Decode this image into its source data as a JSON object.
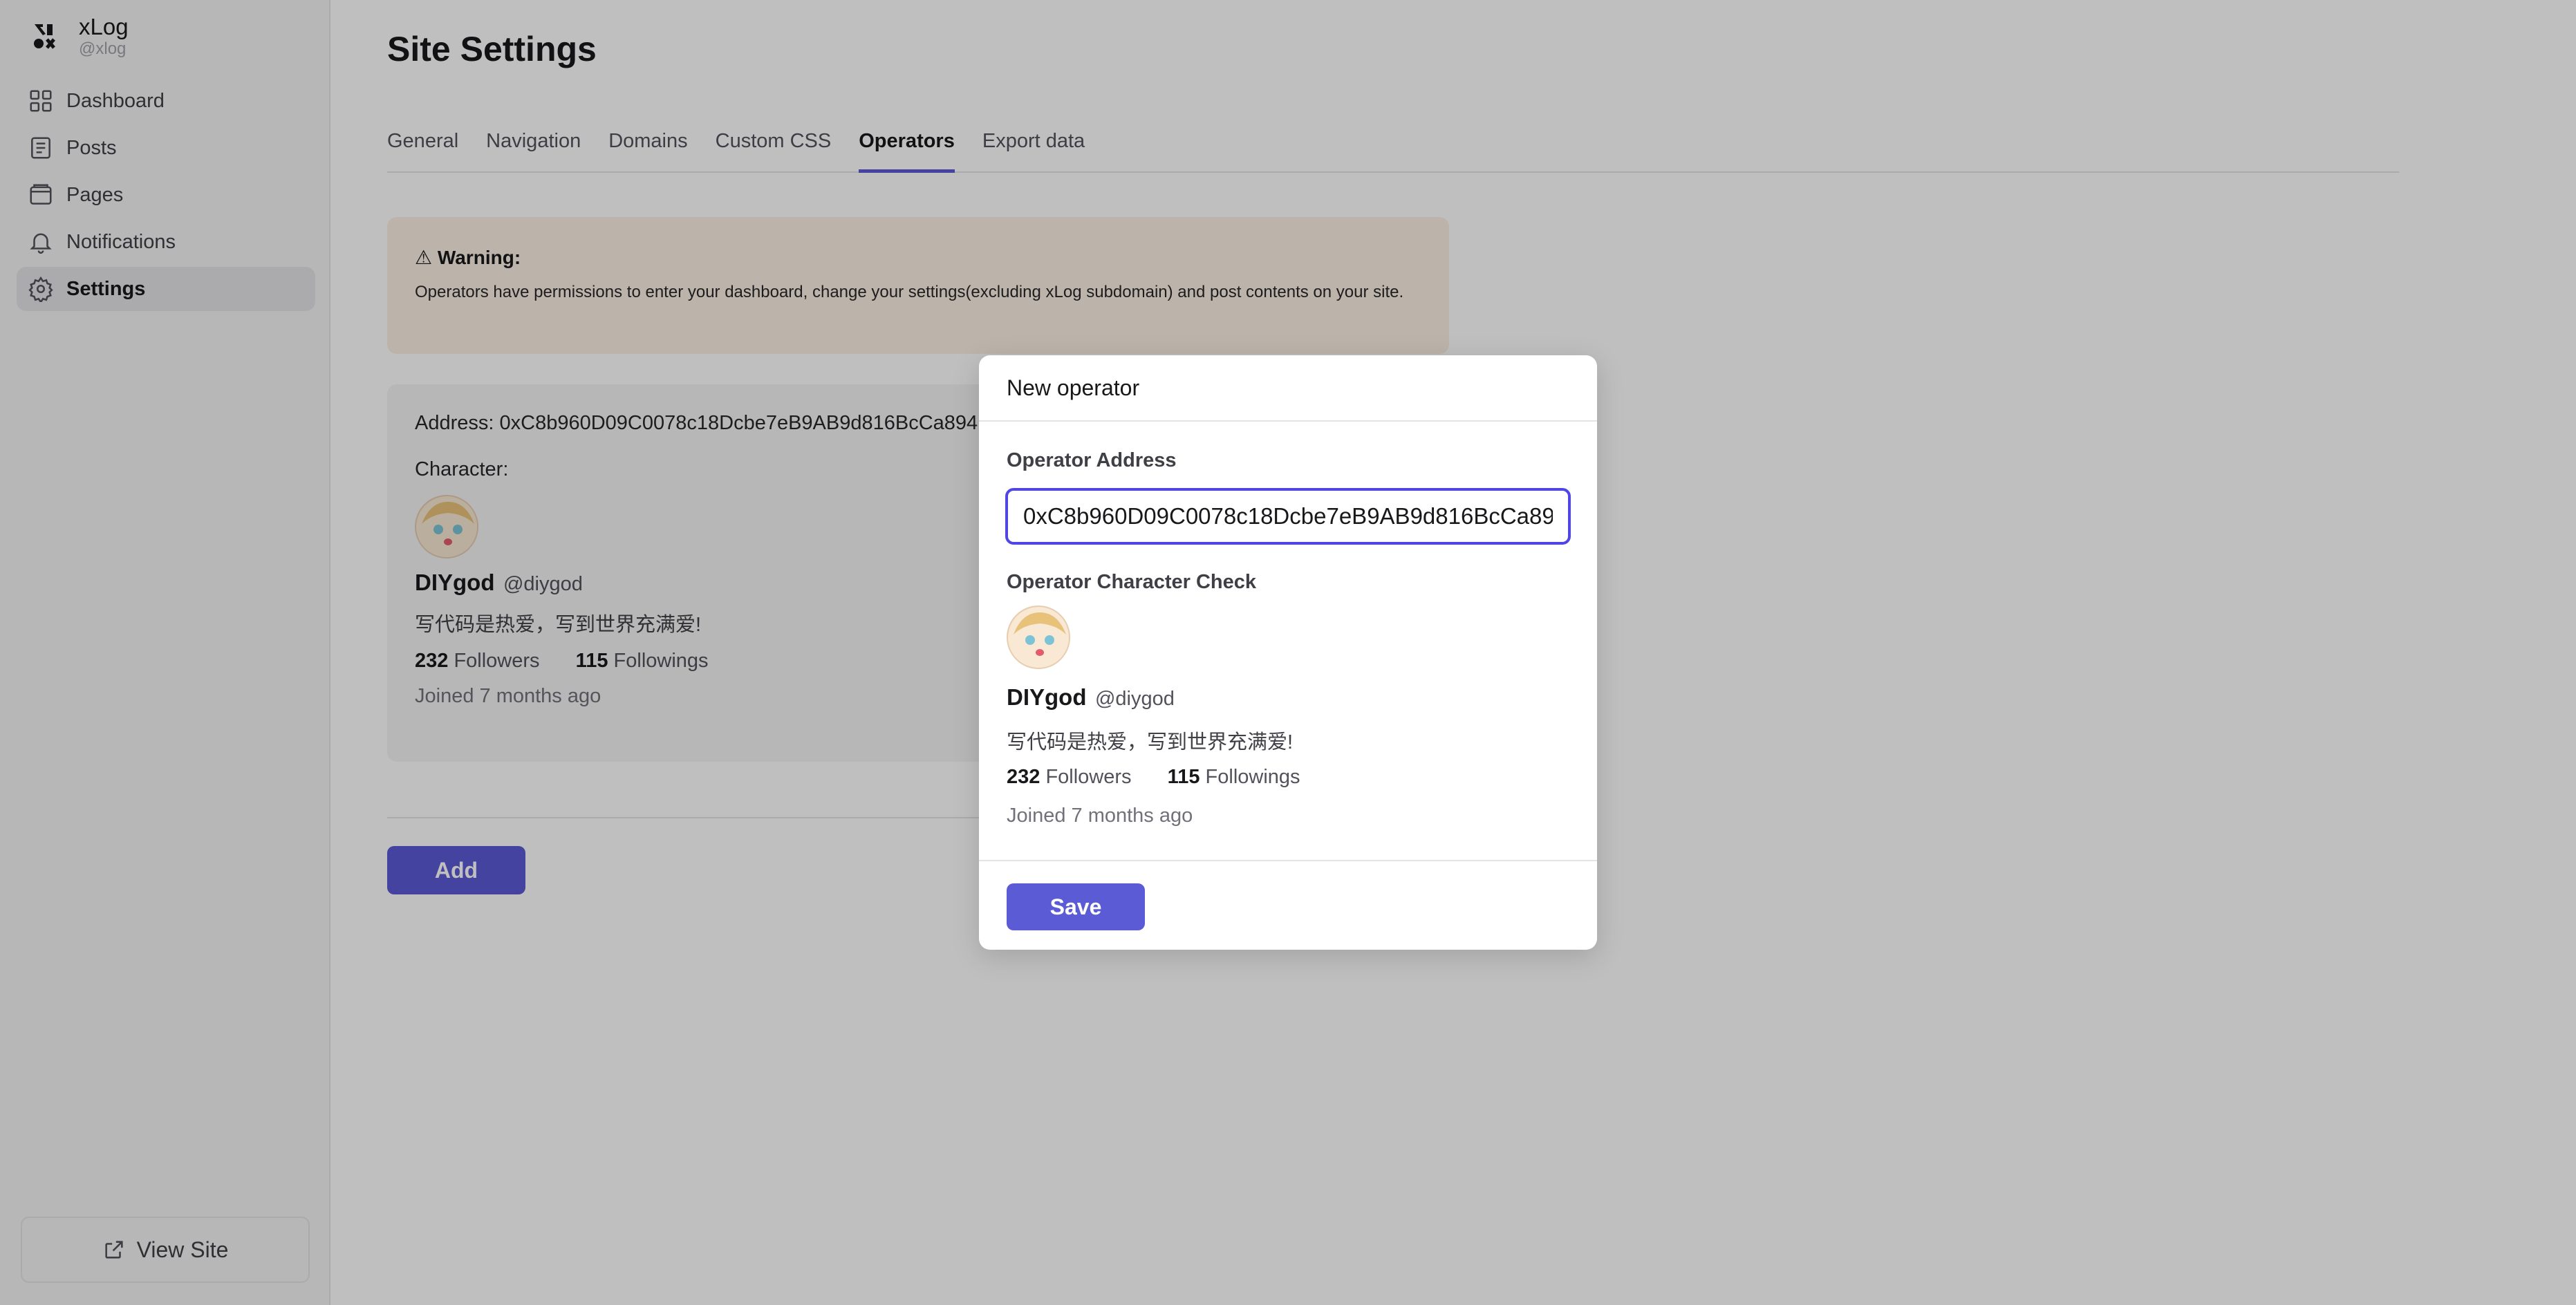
{
  "brand": {
    "name": "xLog",
    "handle": "@xlog"
  },
  "sidebar": {
    "items": [
      {
        "label": "Dashboard",
        "icon": "dashboard-icon"
      },
      {
        "label": "Posts",
        "icon": "posts-icon"
      },
      {
        "label": "Pages",
        "icon": "pages-icon"
      },
      {
        "label": "Notifications",
        "icon": "bell-icon"
      },
      {
        "label": "Settings",
        "icon": "gear-icon",
        "active": true
      }
    ],
    "view_site": "View Site"
  },
  "page": {
    "title": "Site Settings"
  },
  "tabs": [
    {
      "label": "General"
    },
    {
      "label": "Navigation"
    },
    {
      "label": "Domains"
    },
    {
      "label": "Custom CSS"
    },
    {
      "label": "Operators",
      "active": true
    },
    {
      "label": "Export data"
    }
  ],
  "warning": {
    "title": "⚠ Warning:",
    "text": "Operators have permissions to enter your dashboard, change your settings(excluding xLog subdomain) and post contents on your site."
  },
  "operator": {
    "address_line": "Address: 0xC8b960D09C0078c18Dcbe7eB9AB9d816BcCa894",
    "character_label": "Character:",
    "name": "DIYgod",
    "handle": "@diygod",
    "bio": "写代码是热爱，写到世界充满爱!",
    "followers_count": "232",
    "followers_label": "Followers",
    "followings_count": "115",
    "followings_label": "Followings",
    "joined": "Joined 7 months ago"
  },
  "add_button": "Add",
  "modal": {
    "title": "New operator",
    "address_label": "Operator Address",
    "address_value": "0xC8b960D09C0078c18Dcbe7eB9AB9d816BcCa89",
    "check_label": "Operator Character Check",
    "save_button": "Save"
  },
  "colors": {
    "accent": "#5b5bd6",
    "input_border": "#4f46e5",
    "warning_bg": "#fbefe3"
  }
}
